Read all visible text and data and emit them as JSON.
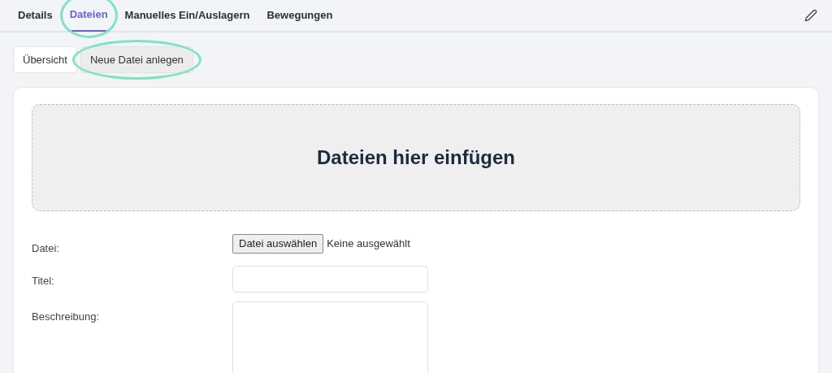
{
  "tabs": [
    {
      "label": "Details",
      "selected": false,
      "highlighted": false
    },
    {
      "label": "Dateien",
      "selected": true,
      "highlighted": true
    },
    {
      "label": "Manuelles Ein/Auslagern",
      "selected": false,
      "highlighted": false
    },
    {
      "label": "Bewegungen",
      "selected": false,
      "highlighted": false
    }
  ],
  "subtabs": [
    {
      "label": "Übersicht",
      "selected": false,
      "highlighted": false
    },
    {
      "label": "Neue Datei anlegen",
      "selected": true,
      "highlighted": true
    }
  ],
  "dropzone": {
    "text": "Dateien hier einfügen"
  },
  "form": {
    "file": {
      "label": "Datei:",
      "button": "Datei auswählen",
      "status": "Keine ausgewählt"
    },
    "title": {
      "label": "Titel:"
    },
    "description": {
      "label": "Beschreibung:"
    }
  }
}
